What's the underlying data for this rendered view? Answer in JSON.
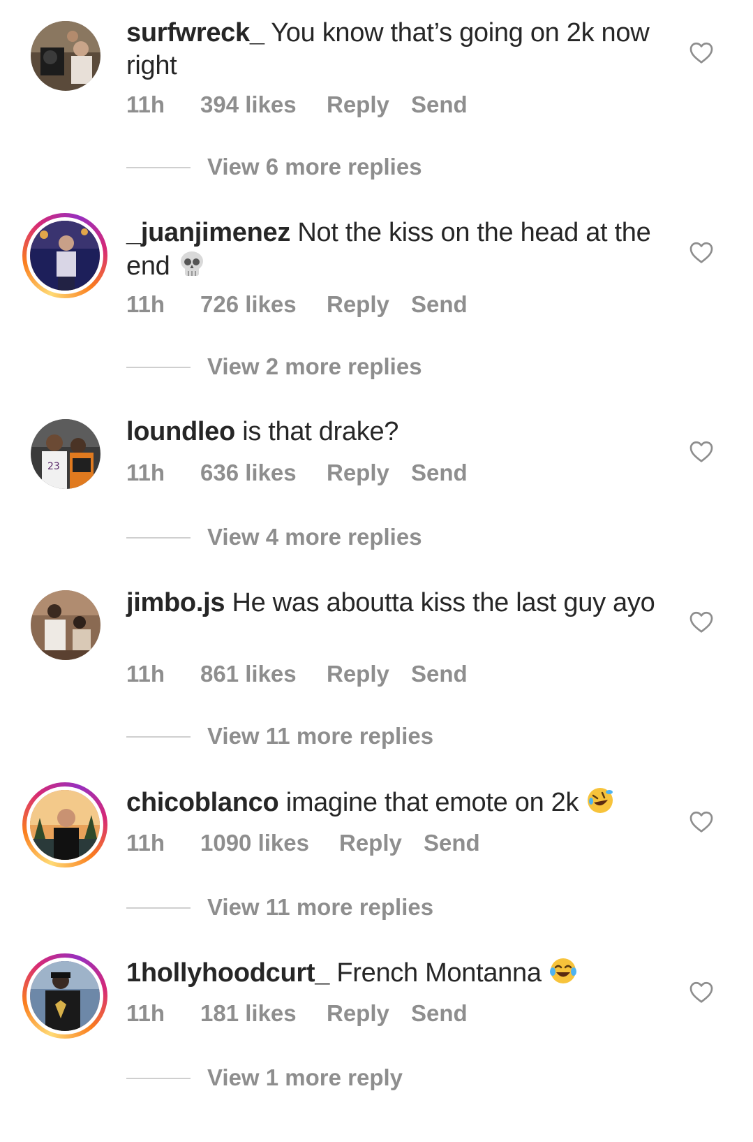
{
  "comments": [
    {
      "username": "surfwreck_",
      "text": "You know that’s going on 2k now right",
      "emoji": "",
      "time": "11h",
      "likes": "394 likes",
      "reply_label": "Reply",
      "send_label": "Send",
      "view_replies": "View 6 more replies",
      "story_ring": false
    },
    {
      "username": "_juanjimenez",
      "text": "Not the kiss on the head at the end",
      "emoji": "skull",
      "time": "11h",
      "likes": "726 likes",
      "reply_label": "Reply",
      "send_label": "Send",
      "view_replies": "View 2 more replies",
      "story_ring": true
    },
    {
      "username": "loundleo",
      "text": "is that drake?",
      "emoji": "",
      "time": "11h",
      "likes": "636 likes",
      "reply_label": "Reply",
      "send_label": "Send",
      "view_replies": "View 4 more replies",
      "story_ring": false
    },
    {
      "username": "jimbo.js",
      "text": "He was aboutta kiss the last guy ayo",
      "emoji": "",
      "time": "11h",
      "likes": "861 likes",
      "reply_label": "Reply",
      "send_label": "Send",
      "view_replies": "View 11 more replies",
      "story_ring": false
    },
    {
      "username": "chicoblanco",
      "text": "imagine that emote on 2k",
      "emoji": "rofl",
      "time": "11h",
      "likes": "1090 likes",
      "reply_label": "Reply",
      "send_label": "Send",
      "view_replies": "View 11 more replies",
      "story_ring": true
    },
    {
      "username": "1hollyhoodcurt_",
      "text": "French Montanna",
      "emoji": "joy",
      "time": "11h",
      "likes": "181 likes",
      "reply_label": "Reply",
      "send_label": "Send",
      "view_replies": "View 1 more reply",
      "story_ring": true
    }
  ],
  "icons": {
    "like": "heart-outline-icon",
    "skull": "skull-emoji",
    "rofl": "rolling-on-floor-laughing-emoji",
    "joy": "tears-of-joy-emoji"
  },
  "colors": {
    "text": "#262626",
    "secondary": "#8e8e8e",
    "story_ring": [
      "#feda75",
      "#fa7e1e",
      "#d62976",
      "#962fbf"
    ]
  }
}
